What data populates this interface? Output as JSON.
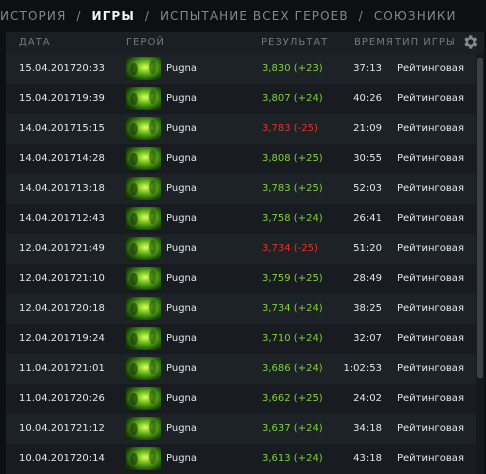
{
  "nav": {
    "tabs": [
      {
        "label": "ИСТОРИЯ"
      },
      {
        "label": "ИГРЫ"
      },
      {
        "label": "ИСПЫТАНИЕ ВСЕХ ГЕРОЕВ"
      },
      {
        "label": "СОЮЗНИКИ"
      }
    ],
    "separator": "/",
    "active_tab": "ИГРЫ"
  },
  "table": {
    "headers": {
      "date": "ДАТА",
      "hero": "ГЕРОЙ",
      "result": "РЕЗУЛЬТАТ",
      "duration": "ВРЕМЯ",
      "type": "ТИП ИГРЫ"
    },
    "settings_icon": "gear-icon",
    "rows": [
      {
        "date": "15.04.2017",
        "time": "20:33",
        "hero": "Pugna",
        "result": "3,830 (+23)",
        "outcome": "win",
        "duration": "37:13",
        "type": "Рейтинговая"
      },
      {
        "date": "15.04.2017",
        "time": "19:39",
        "hero": "Pugna",
        "result": "3,807 (+24)",
        "outcome": "win",
        "duration": "40:26",
        "type": "Рейтинговая"
      },
      {
        "date": "14.04.2017",
        "time": "15:15",
        "hero": "Pugna",
        "result": "3,783 (-25)",
        "outcome": "loss",
        "duration": "21:09",
        "type": "Рейтинговая"
      },
      {
        "date": "14.04.2017",
        "time": "14:28",
        "hero": "Pugna",
        "result": "3,808 (+25)",
        "outcome": "win",
        "duration": "30:55",
        "type": "Рейтинговая"
      },
      {
        "date": "14.04.2017",
        "time": "13:18",
        "hero": "Pugna",
        "result": "3,783 (+25)",
        "outcome": "win",
        "duration": "52:03",
        "type": "Рейтинговая"
      },
      {
        "date": "14.04.2017",
        "time": "12:43",
        "hero": "Pugna",
        "result": "3,758 (+24)",
        "outcome": "win",
        "duration": "26:41",
        "type": "Рейтинговая"
      },
      {
        "date": "12.04.2017",
        "time": "21:49",
        "hero": "Pugna",
        "result": "3,734 (-25)",
        "outcome": "loss",
        "duration": "51:20",
        "type": "Рейтинговая"
      },
      {
        "date": "12.04.2017",
        "time": "21:10",
        "hero": "Pugna",
        "result": "3,759 (+25)",
        "outcome": "win",
        "duration": "28:49",
        "type": "Рейтинговая"
      },
      {
        "date": "12.04.2017",
        "time": "20:18",
        "hero": "Pugna",
        "result": "3,734 (+24)",
        "outcome": "win",
        "duration": "38:25",
        "type": "Рейтинговая"
      },
      {
        "date": "12.04.2017",
        "time": "19:24",
        "hero": "Pugna",
        "result": "3,710 (+24)",
        "outcome": "win",
        "duration": "32:07",
        "type": "Рейтинговая"
      },
      {
        "date": "11.04.2017",
        "time": "21:01",
        "hero": "Pugna",
        "result": "3,686 (+24)",
        "outcome": "win",
        "duration": "1:02:53",
        "type": "Рейтинговая"
      },
      {
        "date": "11.04.2017",
        "time": "20:26",
        "hero": "Pugna",
        "result": "3,662 (+25)",
        "outcome": "win",
        "duration": "24:02",
        "type": "Рейтинговая"
      },
      {
        "date": "10.04.2017",
        "time": "21:12",
        "hero": "Pugna",
        "result": "3,637 (+24)",
        "outcome": "win",
        "duration": "34:18",
        "type": "Рейтинговая"
      },
      {
        "date": "10.04.2017",
        "time": "20:14",
        "hero": "Pugna",
        "result": "3,613 (+24)",
        "outcome": "win",
        "duration": "43:18",
        "type": "Рейтинговая"
      }
    ]
  },
  "colors": {
    "win": "#7fd13b",
    "loss": "#e0352a",
    "background": "#0c1013",
    "panel": "#1a1f23"
  }
}
